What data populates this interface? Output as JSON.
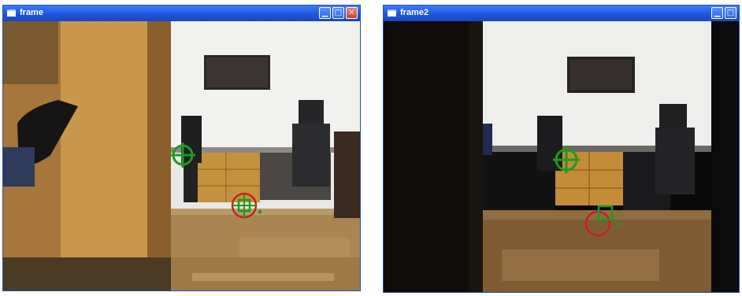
{
  "windows": [
    {
      "title": "frame",
      "controls": [
        "minimize-icon",
        "maximize-icon",
        "close-icon"
      ]
    },
    {
      "title": "frame2",
      "controls": [
        "minimize-icon",
        "maximize-icon"
      ]
    }
  ],
  "colors": {
    "titlebar": "#1f56d8",
    "tracker_green": "#1f9a1f",
    "tracker_red": "#c8201b"
  }
}
